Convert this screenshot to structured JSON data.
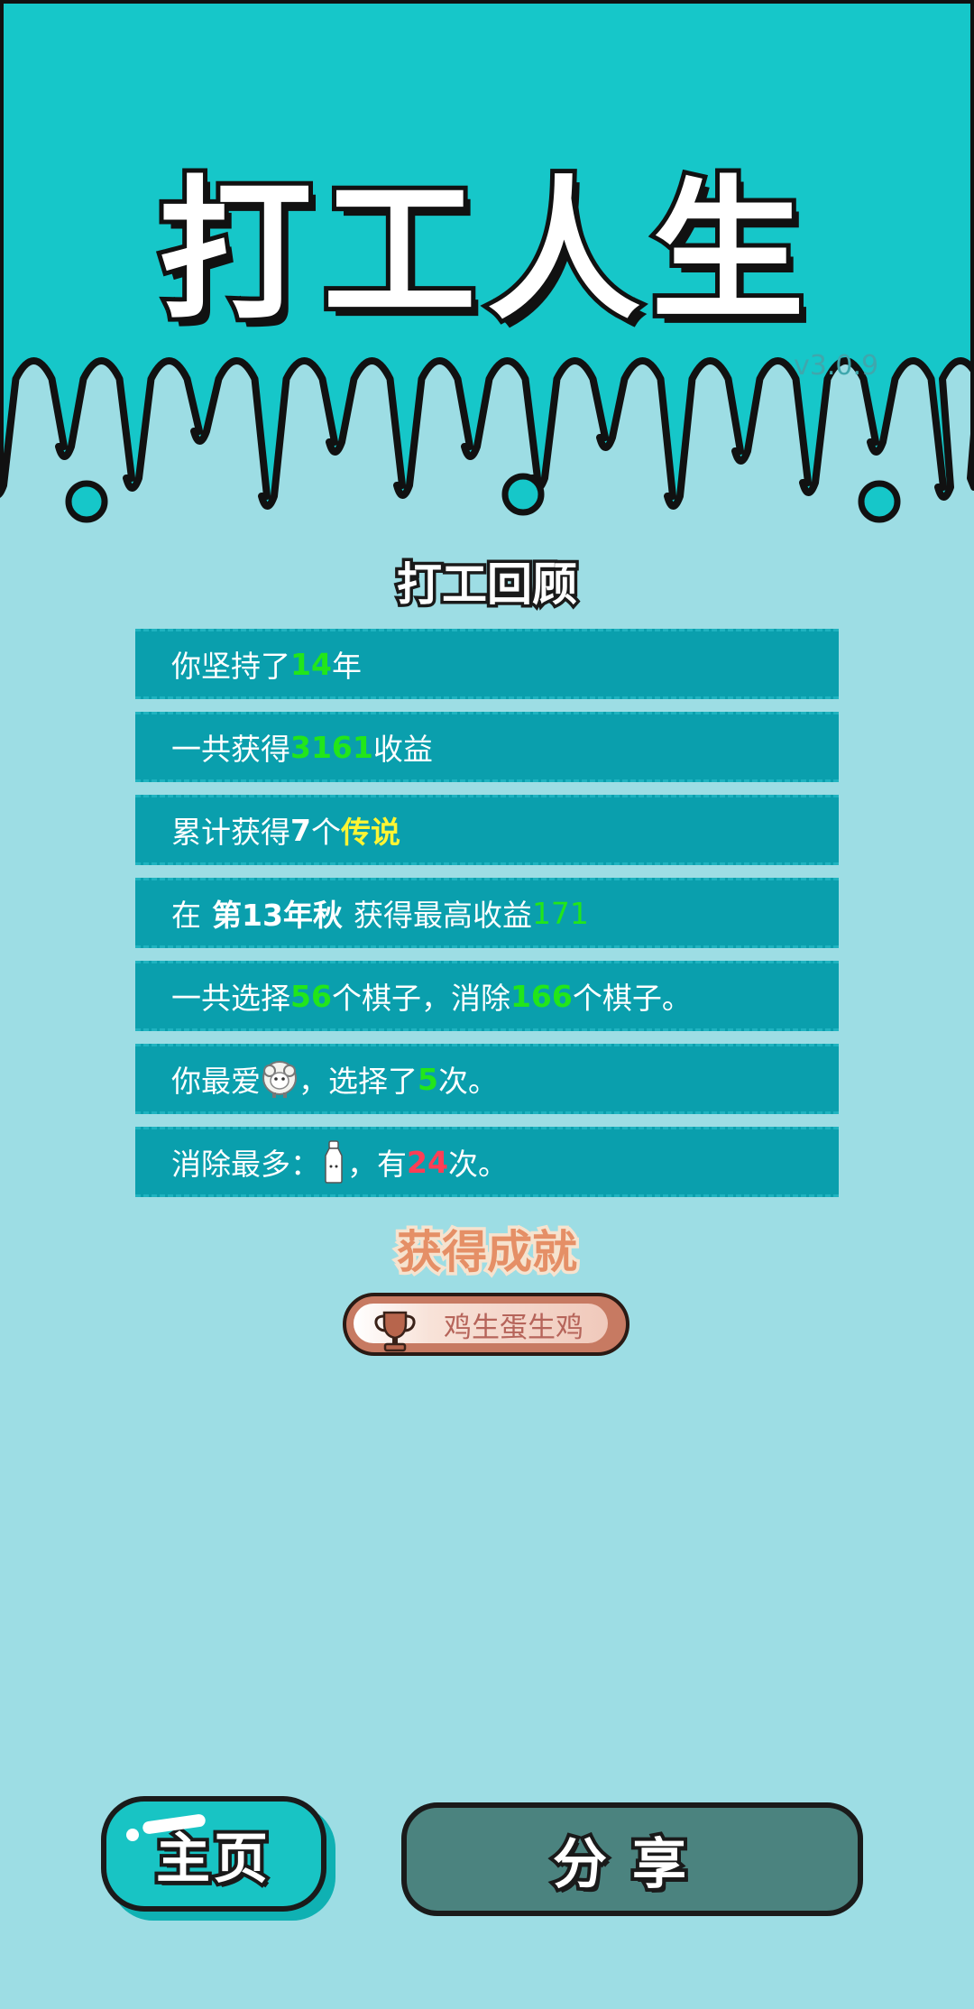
{
  "header": {
    "title": "打工人生",
    "version": "v3.0.9"
  },
  "review": {
    "title": "打工回顾",
    "rows": [
      {
        "parts": [
          "你坚持了",
          "14",
          "年"
        ]
      },
      {
        "parts": [
          "一共获得",
          "3161",
          "收益"
        ]
      },
      {
        "parts": [
          "累计获得",
          "7",
          "个",
          "传说"
        ]
      },
      {
        "parts": [
          "在",
          "第13年秋",
          "获得最高收益",
          "171"
        ]
      },
      {
        "parts": [
          "一共选择",
          "56",
          "个棋子，消除",
          "166",
          "个棋子。"
        ]
      },
      {
        "parts": [
          "你最爱",
          "，选择了",
          "5",
          "次。"
        ],
        "icon": "sheep-icon"
      },
      {
        "parts": [
          "消除最多：",
          "，有",
          "24",
          "次。"
        ],
        "icon": "milk-bottle-icon"
      }
    ]
  },
  "achievements": {
    "title": "获得成就",
    "items": [
      {
        "label": "鸡生蛋生鸡",
        "icon": "trophy-icon"
      }
    ]
  },
  "buttons": {
    "home": "主页",
    "share": "分享"
  },
  "colors": {
    "header_bg": "#16c7c9",
    "page_bg": "#9ddde4",
    "row_bg": "#0a9fad",
    "highlight_green": "#22e61a",
    "highlight_yellow": "#fff533",
    "highlight_red": "#ff3d55",
    "share_button": "#4b837f"
  }
}
